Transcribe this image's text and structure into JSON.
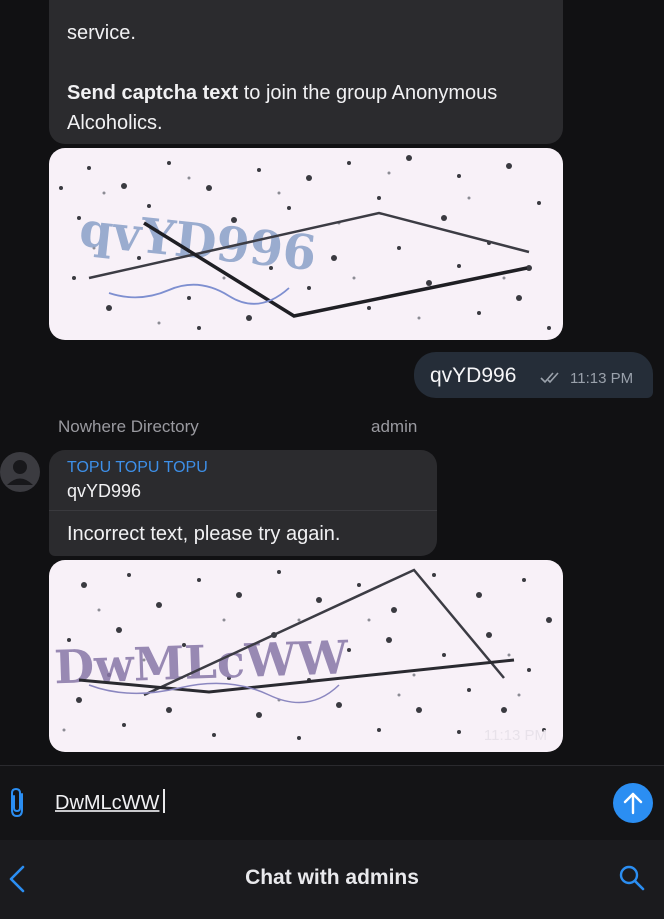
{
  "messages": {
    "welcome": {
      "line1": "service.",
      "bold": "Send captcha text",
      "rest": " to join the group Anonymous Alcoholics."
    },
    "outgoing": {
      "text": "qvYD996",
      "time": "11:13 PM"
    },
    "reply_block": {
      "sender": "Nowhere Directory",
      "role": "admin",
      "reply_to_name": "TOPU TOPU TOPU",
      "reply_to_text": "qvYD996",
      "text": "Incorrect text, please try again."
    },
    "captcha1": {
      "glyphs": "qvYD996"
    },
    "captcha2": {
      "glyphs": "DwMLcWW",
      "time": "11:13 PM"
    }
  },
  "input": {
    "value": "DwMLcWW"
  },
  "footer": {
    "title": "Chat with admins"
  },
  "colors": {
    "accent": "#2b8ef2",
    "bubble_in": "#2b2b2e",
    "bubble_out": "#252d38",
    "background": "#111113"
  },
  "icons": [
    "avatar-icon",
    "double-check-icon",
    "paperclip-icon",
    "send-arrow-icon",
    "back-chevron-icon",
    "search-icon"
  ]
}
